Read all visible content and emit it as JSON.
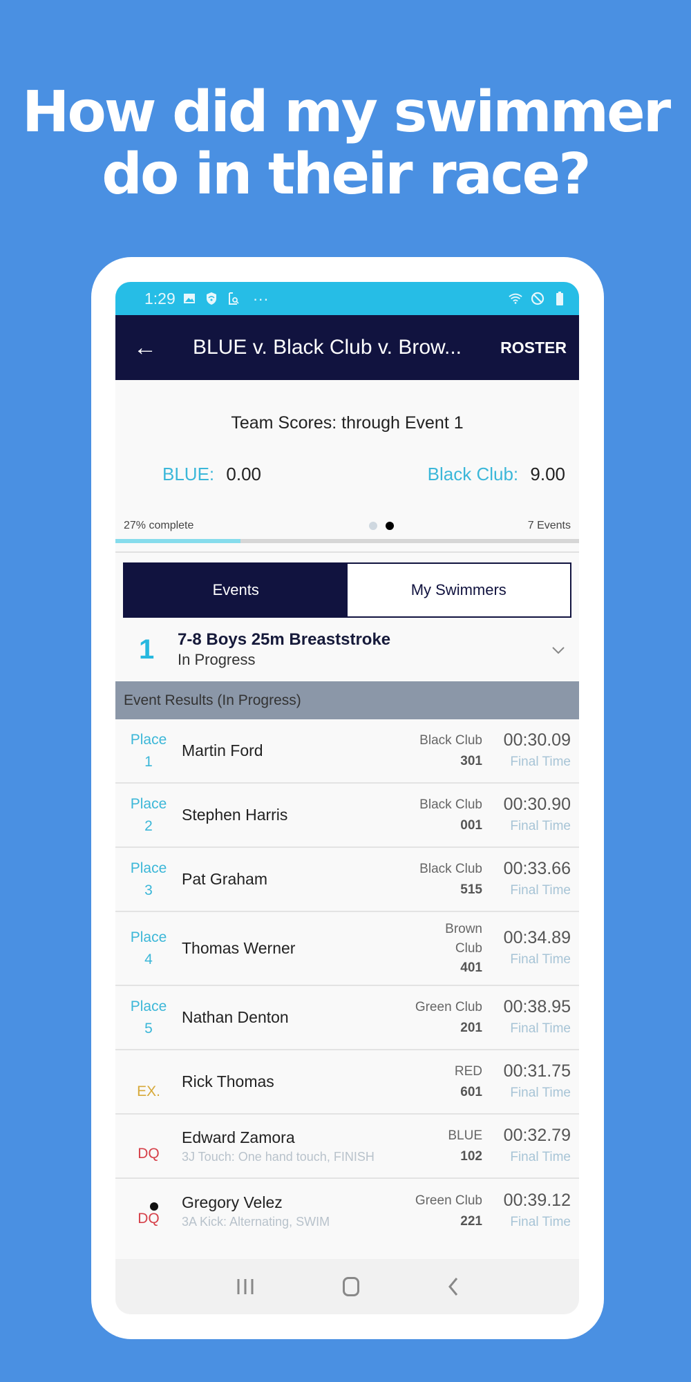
{
  "headline": {
    "line1": "How did my swimmer",
    "line2": "do in their race?"
  },
  "status_bar": {
    "time": "1:29",
    "left_icons": [
      "image-icon",
      "shield-wifi-icon",
      "screenshot-icon",
      "more-dots-icon"
    ],
    "right_icons": [
      "wifi-icon",
      "do-not-disturb-icon",
      "battery-icon"
    ],
    "more": "···"
  },
  "app_bar": {
    "back_icon": "←",
    "title": "BLUE v. Black Club v. Brow...",
    "roster_label": "ROSTER"
  },
  "scores": {
    "title": "Team Scores: through Event 1",
    "teams": [
      {
        "label": "BLUE:",
        "score": "0.00"
      },
      {
        "label": "Black Club:",
        "score": "9.00"
      }
    ],
    "progress_text": "27% complete",
    "progress_percent": 27,
    "events_count": "7 Events",
    "page_dots": 2,
    "active_dot": 1
  },
  "tabs": [
    {
      "label": "Events",
      "active": true
    },
    {
      "label": "My Swimmers",
      "active": false
    }
  ],
  "event": {
    "number": "1",
    "name": "7-8 Boys 25m Breaststroke",
    "status": "In Progress",
    "chevron": "∨"
  },
  "results_header": "Event Results (In Progress)",
  "results": [
    {
      "place_label": "Place",
      "place": "1",
      "name": "Martin Ford",
      "team": "Black Club",
      "team_num": "301",
      "time": "00:30.09",
      "time_label": "Final Time"
    },
    {
      "place_label": "Place",
      "place": "2",
      "name": "Stephen Harris",
      "team": "Black Club",
      "team_num": "001",
      "time": "00:30.90",
      "time_label": "Final Time"
    },
    {
      "place_label": "Place",
      "place": "3",
      "name": "Pat Graham",
      "team": "Black Club",
      "team_num": "515",
      "time": "00:33.66",
      "time_label": "Final Time"
    },
    {
      "place_label": "Place",
      "place": "4",
      "name": "Thomas Werner",
      "team": "Brown Club",
      "team_num": "401",
      "time": "00:34.89",
      "time_label": "Final Time"
    },
    {
      "place_label": "Place",
      "place": "5",
      "name": "Nathan Denton",
      "team": "Green Club",
      "team_num": "201",
      "time": "00:38.95",
      "time_label": "Final Time"
    },
    {
      "place_label": "",
      "place": "EX.",
      "name": "Rick Thomas",
      "team": "RED",
      "team_num": "601",
      "time": "00:31.75",
      "time_label": "Final Time"
    },
    {
      "place_label": "",
      "place": "DQ",
      "name": "Edward Zamora",
      "dq_reason": "3J Touch: One hand touch, FINISH",
      "team": "BLUE",
      "team_num": "102",
      "time": "00:32.79",
      "time_label": "Final Time"
    },
    {
      "place_label": "",
      "place": "DQ",
      "name": "Gregory Velez",
      "dq_reason": "3A Kick: Alternating, SWIM",
      "team": "Green Club",
      "team_num": "221",
      "time": "00:39.12",
      "time_label": "Final Time"
    }
  ],
  "colors": {
    "background": "#4a90e2",
    "status_bar": "#26bde6",
    "app_bar": "#11133f",
    "accent": "#3bb7d9",
    "dq": "#d6414a",
    "ex": "#d7a93a",
    "results_header": "#8b97a8"
  }
}
